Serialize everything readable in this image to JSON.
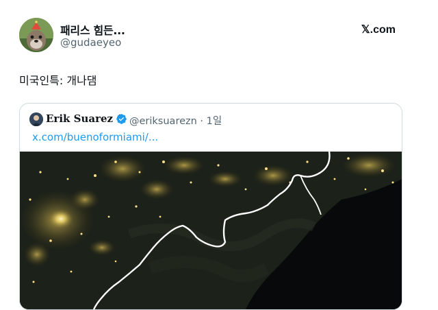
{
  "author": {
    "display_name": "패리스 힘든...",
    "handle": "@gudaeyeo",
    "avatar_icon": "otter-avatar-icon"
  },
  "brand": "𝕏.com",
  "tweet": {
    "text": "미국인특: 개나댐"
  },
  "quote": {
    "name": "Erik Suarez Φ",
    "verified_icon": "verified-badge-icon",
    "meta": "@eriksuarezn · 1일",
    "link": "x.com/buenoformiami/...",
    "media_icon": "night-satellite-map-image"
  }
}
